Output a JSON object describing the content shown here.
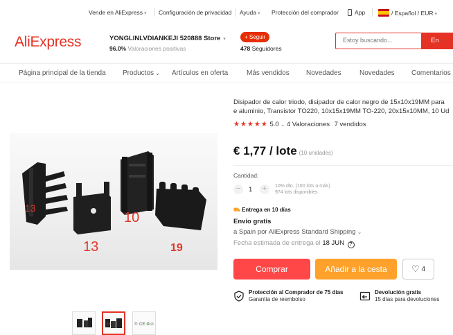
{
  "topbar": {
    "sell": "Vende en AliExpress",
    "privacy": "Configuración de privacidad",
    "help": "Ayuda",
    "protection": "Protección del comprador",
    "app": "App",
    "locale": "/ Español / EUR"
  },
  "header": {
    "logo": "AliExpress",
    "store_name": "YONGLINLVDIANKEJI 520888 Store",
    "positive_pct": "96.0%",
    "positive_label": "Valoraciones positivas",
    "follow_label": "+ Seguir",
    "followers_count": "478",
    "followers_label": "Seguidores",
    "search_placeholder": "Estoy buscando...",
    "search_button": "En AliEx"
  },
  "nav": {
    "home": "Página principal de la tienda",
    "products": "Productos",
    "offers": "Artículos en oferta",
    "best": "Más vendidos",
    "new1": "Novedades",
    "new2": "Novedades",
    "reviews": "Comentarios"
  },
  "product": {
    "title_line1": "Disipador de calor triodo, disipador de calor negro de 15x10x19MM para",
    "title_line2": "e aluminio, Transistor TO220, 10x15x19MM TO-220, 20x15x10MM, 10 Ud",
    "stars": "★★★★★",
    "rating": "5.0",
    "reviews": "4 Valoraciones",
    "sold": "7 vendidos",
    "price": "€ 1,77 / lote",
    "price_unit": "(10 unidades)",
    "image_labels": [
      "13",
      "10",
      "13",
      "19"
    ]
  },
  "quantity": {
    "label": "Cantidad:",
    "value": "1",
    "minus": "−",
    "plus": "+",
    "discount": "10% dto. (100 lots o más)",
    "available": "974 lots disponibles"
  },
  "shipping": {
    "badge": "Entrega en 10 días",
    "free": "Envío gratis",
    "via": "a Spain por AliExpress Standard Shipping",
    "date_prefix": "Fecha estimada de entrega el",
    "date": "18 JUN"
  },
  "actions": {
    "buy": "Comprar",
    "cart": "Añadir a la cesta",
    "wish_count": "4"
  },
  "guarantees": {
    "protection_title": "Protección al Comprador de 75 días",
    "protection_sub": "Garantía de reembolso",
    "return_title": "Devolución gratis",
    "return_sub": "15 días para devoluciones"
  },
  "colors": {
    "brand_red": "#e43225",
    "buy": "#ff4747",
    "cart": "#ffa12b"
  }
}
